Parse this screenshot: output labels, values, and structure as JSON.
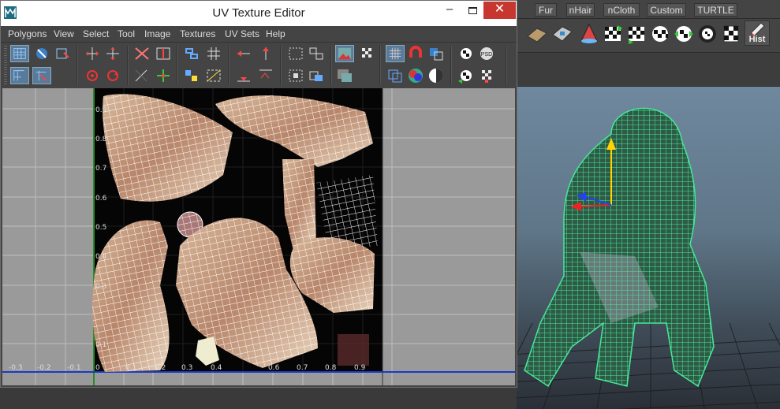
{
  "window": {
    "title": "UV Texture Editor",
    "minimize": "–",
    "close": "✕"
  },
  "menu": {
    "items": [
      "Polygons",
      "View",
      "Select",
      "Tool",
      "Image",
      "Textures",
      "UV Sets",
      "Help"
    ]
  },
  "toolbar": {
    "icons": [
      "uv-select-icon",
      "uv-lasso-icon",
      "uv-move-icon",
      "flip-u-icon",
      "flip-v-icon",
      "rotate-ccw-icon",
      "rotate-cw-icon",
      "cut-uv-icon",
      "sew-uv-icon",
      "align-uv-icon",
      "grid-uv-icon",
      "straighten-icon",
      "unfold-icon",
      "layout-icon",
      "image-display-icon",
      "checker-icon",
      "grid-toggle-icon",
      "snap-magnet-icon",
      "shaded-uv-icon",
      "distortion-icon",
      "psd-icon",
      "uv-snapshot-icon"
    ]
  },
  "canvas": {
    "u_ticks": [
      "-0.3",
      "-0.2",
      "-0.1",
      "0",
      "0.1",
      "0.2",
      "0.3",
      "0.4",
      "0.6",
      "0.7",
      "0.8",
      "0.9"
    ],
    "v_ticks": [
      "0.1",
      "0.9",
      "0.8",
      "0.7",
      "0.6",
      "0.5",
      "0.4",
      "0.3"
    ]
  },
  "maya": {
    "shelf_tabs": [
      "Fur",
      "nHair",
      "nCloth",
      "Custom",
      "TURTLE"
    ],
    "hist_label": "Hist",
    "accent_wire": "#46e89a",
    "viewport_bg": "#6f889e"
  }
}
